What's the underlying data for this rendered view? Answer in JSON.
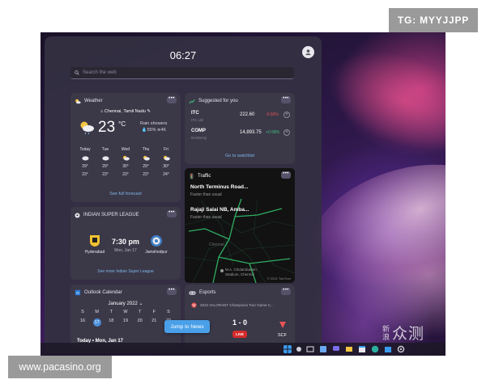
{
  "overlays": {
    "tg_label": "TG: MYYJJPP",
    "site_label": "www.pacasino.org",
    "watermark_small": "新浪",
    "watermark_large": "众测"
  },
  "panel": {
    "time": "06:27",
    "search_placeholder": "Search the web",
    "jump_button": "Jump to News"
  },
  "weather": {
    "title": "Weather",
    "location": "Chennai, Tamil Nadu",
    "temp": "23",
    "unit": "°C",
    "condition": "Rain showers",
    "precip": "55%",
    "wind": "46",
    "days": [
      {
        "day": "Today",
        "high": "29°",
        "low": "23°"
      },
      {
        "day": "Tue",
        "high": "29°",
        "low": "23°"
      },
      {
        "day": "Wed",
        "high": "30°",
        "low": "23°"
      },
      {
        "day": "Thu",
        "high": "29°",
        "low": "23°"
      },
      {
        "day": "Fri",
        "high": "30°",
        "low": "24°"
      }
    ],
    "link": "See full forecast"
  },
  "suggested": {
    "title": "Suggested for you",
    "stocks": [
      {
        "symbol": "ITC",
        "sub": "ITC Ltd",
        "price": "222.60",
        "change": "-0.66%",
        "change_color": "#e55454"
      },
      {
        "symbol": "COMP",
        "sub": "NASDAQ",
        "price": "14,893.75",
        "change": "+0.58%",
        "change_color": "#3fbf7a"
      }
    ],
    "link": "Go to watchlist"
  },
  "traffic": {
    "title": "Traffic",
    "road1": "North Terminus Road...",
    "road1_sub": "Faster than usual",
    "road2": "Rajaji Salai NB, Amba...",
    "road2_sub": "Faster than usual",
    "place": "M.A. Chidambaram\nStadium, Chennai",
    "city": "Chennai",
    "copyright": "© 2021 TomTom"
  },
  "isl": {
    "title": "INDIAN SUPER LEAGUE",
    "home": "Hyderabad",
    "away": "Jamshedpur",
    "time": "7:30 pm",
    "date": "Mon, Jan 17",
    "link": "See more Indian Super League"
  },
  "calendar": {
    "title": "Outlook Calendar",
    "month": "January 2022",
    "weekdays": [
      "S",
      "M",
      "T",
      "W",
      "T",
      "F",
      "S"
    ],
    "dates": [
      "16",
      "17",
      "18",
      "19",
      "20",
      "21",
      "22"
    ],
    "today_label": "Today • Mon, Jan 17"
  },
  "esports": {
    "title": "Esports",
    "event": "2022 VALORANT Champions Tour Game C...",
    "score": "1 - 0",
    "status": "LIVE",
    "team_right": "SCF"
  },
  "colors": {
    "accent": "#4aa0e8",
    "link": "#7fb6e6",
    "live": "#d42a2a",
    "panel": "#34304a"
  }
}
